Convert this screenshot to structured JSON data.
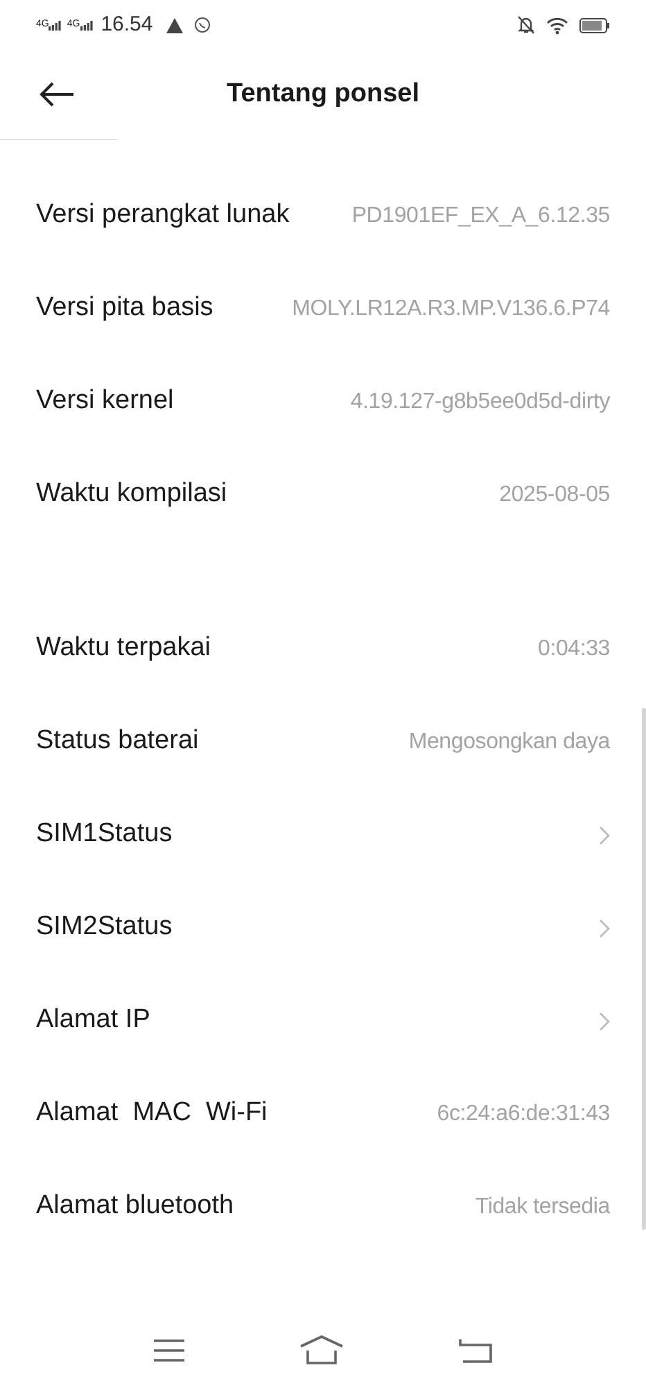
{
  "status_bar": {
    "time": "16.54",
    "network": [
      "4G",
      "4G"
    ]
  },
  "header": {
    "title": "Tentang ponsel"
  },
  "groups": [
    {
      "rows": [
        {
          "kind": "value",
          "label": "Versi perangkat lunak",
          "value": "PD1901EF_EX_A_6.12.35"
        },
        {
          "kind": "value",
          "label": "Versi pita basis",
          "value": "MOLY.LR12A.R3.MP.V136.6.P74"
        },
        {
          "kind": "value",
          "label": "Versi kernel",
          "value": "4.19.127-g8b5ee0d5d-dirty"
        },
        {
          "kind": "value",
          "label": "Waktu kompilasi",
          "value": "2025-08-05"
        }
      ]
    },
    {
      "rows": [
        {
          "kind": "value",
          "label": "Waktu terpakai",
          "value": "0:04:33"
        },
        {
          "kind": "value",
          "label": "Status baterai",
          "value": "Mengosongkan daya"
        },
        {
          "kind": "link",
          "label": "SIM1Status"
        },
        {
          "kind": "link",
          "label": "SIM2Status"
        },
        {
          "kind": "link",
          "label": "Alamat IP"
        },
        {
          "kind": "value",
          "label": "Alamat  MAC  Wi-Fi",
          "value": "6c:24:a6:de:31:43"
        },
        {
          "kind": "value",
          "label": "Alamat bluetooth",
          "value": "Tidak tersedia"
        }
      ]
    }
  ]
}
